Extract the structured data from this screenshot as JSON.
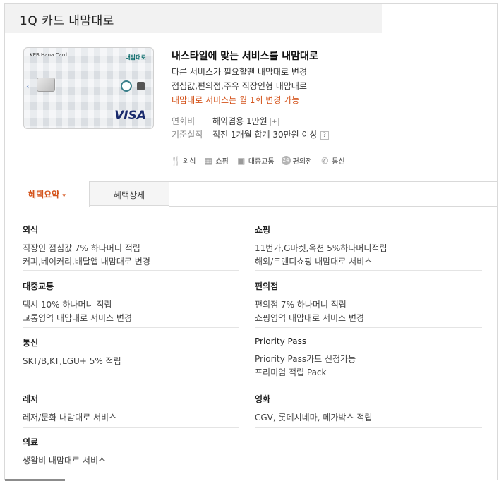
{
  "page": {
    "title": "1Q 카드 내맘대로"
  },
  "card": {
    "image": {
      "brand": "KEB Hana Card",
      "name_tag": "내맘대로",
      "network": "VISA"
    },
    "info": {
      "headline": "내스타일에 맞는 서비스를 내맘대로",
      "lines": [
        "다른 서비스가 필요할땐 내맘대로 변경",
        "점심값,편의점,주유 직장인형 내맘대로"
      ],
      "highlight": "내맘대로 서비스는 월 1회 변경 가능"
    },
    "meta": [
      {
        "label": "연회비",
        "value": "해외겸용 1만원",
        "suffix_icon": "+"
      },
      {
        "label": "기준실적",
        "value": "직전 1개월 합계 30만원 이상",
        "suffix_icon": "?"
      }
    ],
    "benefits": [
      {
        "icon": "fork-knife-icon",
        "label": "외식"
      },
      {
        "icon": "gift-icon",
        "label": "쇼핑"
      },
      {
        "icon": "bus-icon",
        "label": "대중교통"
      },
      {
        "icon": "24-store-icon",
        "label": "편의점"
      },
      {
        "icon": "phone-icon",
        "label": "통신"
      }
    ]
  },
  "tabs": [
    {
      "label": "혜택요약",
      "caret": "▾",
      "active": true
    },
    {
      "label": "혜택상세",
      "active": false
    }
  ],
  "summary": {
    "rows": [
      [
        {
          "title": "외식",
          "lines": [
            "직장인 점심값 7% 하나머니 적립",
            "커피,베이커리,배달앱 내맘대로 변경"
          ]
        },
        {
          "title": "쇼핑",
          "lines": [
            "11번가,G마켓,옥션 5%하나머니적립",
            "해외/트렌디쇼핑 내맘대로 서비스"
          ]
        }
      ],
      [
        {
          "title": "대중교통",
          "lines": [
            "택시 10% 하나머니 적립",
            "교통영역 내맘대로 서비스 변경"
          ]
        },
        {
          "title": "편의점",
          "lines": [
            "편의점 7% 하나머니 적립",
            "쇼핑영역 내맘대로 서비스 변경"
          ]
        }
      ],
      [
        {
          "title": "통신",
          "lines": [
            "SKT/B,KT,LGU+ 5% 적립"
          ]
        },
        {
          "title": "Priority Pass",
          "lines": [
            "Priority Pass카드 신청가능",
            "프리미엄 적립 Pack"
          ]
        }
      ],
      [
        {
          "title": "레저",
          "lines": [
            "레저/문화 내맘대로 서비스"
          ]
        },
        {
          "title": "영화",
          "lines": [
            "CGV, 롯데시네마, 메가박스 적립"
          ]
        }
      ],
      [
        {
          "title": "의료",
          "lines": [
            "생활비 내맘대로 서비스"
          ]
        }
      ]
    ]
  },
  "colors": {
    "accent": "#d4541c",
    "title_bar": "#f2f2f2",
    "border": "#d9d9d9"
  }
}
